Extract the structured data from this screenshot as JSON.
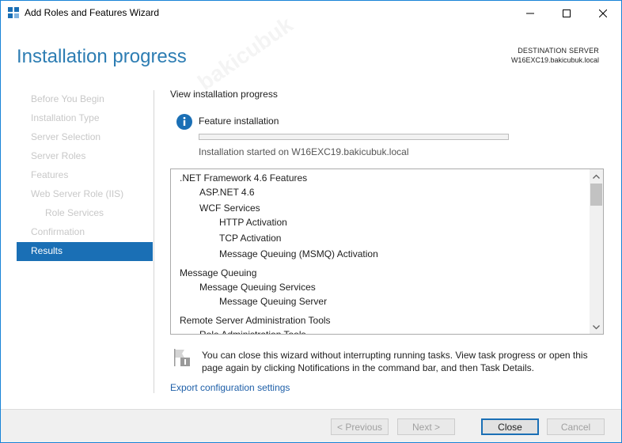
{
  "window": {
    "title": "Add Roles and Features Wizard"
  },
  "header": {
    "page_title": "Installation progress",
    "destination_label": "DESTINATION SERVER",
    "destination_server": "W16EXC19.bakicubuk.local"
  },
  "nav": {
    "items": [
      {
        "label": "Before You Begin",
        "state": "disabled",
        "level": 0
      },
      {
        "label": "Installation Type",
        "state": "disabled",
        "level": 0
      },
      {
        "label": "Server Selection",
        "state": "disabled",
        "level": 0
      },
      {
        "label": "Server Roles",
        "state": "disabled",
        "level": 0
      },
      {
        "label": "Features",
        "state": "disabled",
        "level": 0
      },
      {
        "label": "Web Server Role (IIS)",
        "state": "disabled",
        "level": 0
      },
      {
        "label": "Role Services",
        "state": "disabled",
        "level": 1
      },
      {
        "label": "Confirmation",
        "state": "disabled",
        "level": 0
      },
      {
        "label": "Results",
        "state": "active",
        "level": 0
      }
    ]
  },
  "main": {
    "view_label": "View installation progress",
    "feature_label": "Feature installation",
    "progress": 0,
    "started_text": "Installation started on W16EXC19.bakicubuk.local",
    "features": [
      {
        "label": ".NET Framework 4.6 Features",
        "level": 0
      },
      {
        "label": "ASP.NET 4.6",
        "level": 1
      },
      {
        "label": "WCF Services",
        "level": 1
      },
      {
        "label": "HTTP Activation",
        "level": 2
      },
      {
        "label": "TCP Activation",
        "level": 2
      },
      {
        "label": "Message Queuing (MSMQ) Activation",
        "level": 2
      },
      {
        "label": "Message Queuing",
        "level": 0
      },
      {
        "label": "Message Queuing Services",
        "level": 1
      },
      {
        "label": "Message Queuing Server",
        "level": 2
      },
      {
        "label": "Remote Server Administration Tools",
        "level": 0
      },
      {
        "label": "Role Administration Tools",
        "level": 1
      }
    ],
    "notice_text": "You can close this wizard without interrupting running tasks. View task progress or open this page again by clicking Notifications in the command bar, and then Task Details.",
    "export_link": "Export configuration settings"
  },
  "footer": {
    "previous_label": "< Previous",
    "next_label": "Next >",
    "close_label": "Close",
    "cancel_label": "Cancel"
  },
  "watermark": "bakicubuk",
  "colors": {
    "accent": "#1a6fb5",
    "title_blue": "#2d7db3",
    "link": "#1e5fa8",
    "progress_green": "#06b025"
  },
  "icons": {
    "app": "wizard-app-icon",
    "info": "info-icon",
    "notice": "notification-flag-icon"
  }
}
